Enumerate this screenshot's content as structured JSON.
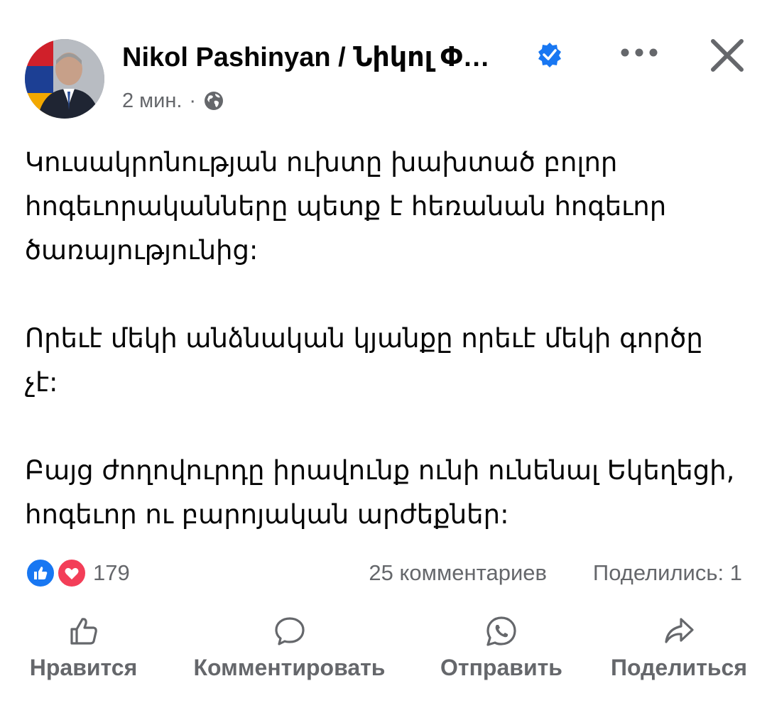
{
  "post": {
    "author": "Nikol Pashinyan / Նիկոլ Փ…",
    "time": "2 мин.",
    "separator": "·",
    "avatar_icon": "profile-photo",
    "verified_icon": "verified-badge-icon",
    "privacy_icon": "globe-icon",
    "paragraphs": [
      "Կուսակրոնության ուխտը խախտած բոլոր հոգեւորականները պետք է հեռանան հոգեւոր ծառայությունից:",
      "Որեւէ մեկի անձնական կյանքը որեւէ մեկի գործը չէ:",
      "Բայց ժողովուրդը իրավունք ունի ունենալ Եկեղեցի, հոգեւոր ու բարոյական արժեքներ:"
    ]
  },
  "stats": {
    "reaction_count": "179",
    "comments": "25 комментариев",
    "shares": "Поделились: 1"
  },
  "actions": {
    "like": "Нравится",
    "comment": "Комментировать",
    "send": "Отправить",
    "share": "Поделиться"
  },
  "colors": {
    "accent_blue": "#1877f2",
    "love_red": "#f33e58",
    "secondary_text": "#65676b",
    "primary_text": "#050505"
  }
}
